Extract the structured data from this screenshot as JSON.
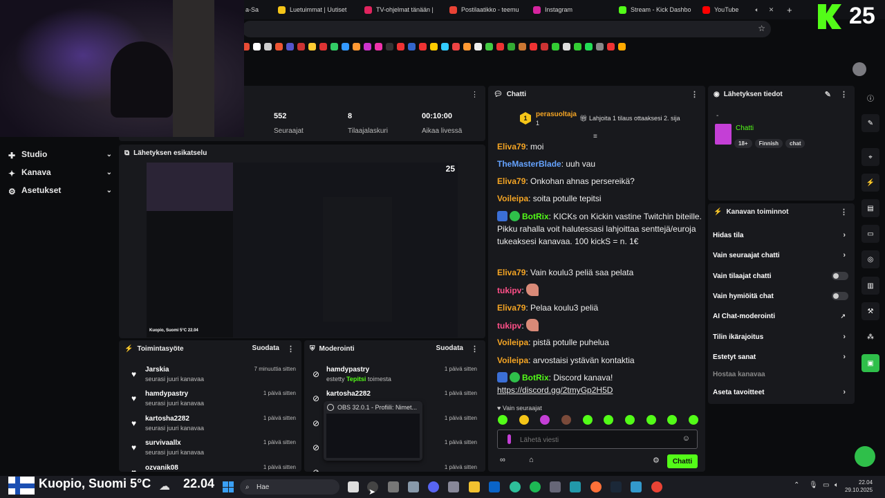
{
  "browser": {
    "tabs": [
      {
        "label": "a-Sa",
        "color": "#6aa6ff"
      },
      {
        "label": "Luetuimmat | Uutiset",
        "color": "#f5c518"
      },
      {
        "label": "TV-ohjelmat tänään |",
        "color": "#e0245e"
      },
      {
        "label": "Postilaatikko - teemu",
        "color": "#ea4335"
      },
      {
        "label": "Instagram",
        "color": "#d6249f"
      },
      {
        "label": "Stream - Kick Dashbo",
        "color": "#53fc18"
      },
      {
        "label": "YouTube",
        "color": "#ff0000"
      }
    ],
    "overlay_count": "25"
  },
  "nav": {
    "items": [
      {
        "label": "Studio"
      },
      {
        "label": "Kanava"
      },
      {
        "label": "Asetukset"
      }
    ]
  },
  "stats": [
    {
      "value": "552",
      "label": "Seuraajat"
    },
    {
      "value": "8",
      "label": "Tilaajalaskuri"
    },
    {
      "value": "00:10:00",
      "label": "Aikaa livessä"
    }
  ],
  "preview": {
    "title": "Lähetyksen esikatselu",
    "location": "Kuopio, Suomi 5°C 22.04",
    "count": "25"
  },
  "activity": {
    "title": "Toimintasyöte",
    "filter": "Suodata",
    "rows": [
      {
        "name": "Jarskia",
        "sub": "seurasi juuri kanavaa",
        "time": "7 minuuttia sitten"
      },
      {
        "name": "hamdypastry",
        "sub": "seurasi juuri kanavaa",
        "time": "1 päivä sitten"
      },
      {
        "name": "kartosha2282",
        "sub": "seurasi juuri kanavaa",
        "time": "1 päivä sitten"
      },
      {
        "name": "survivaallx",
        "sub": "seurasi juuri kanavaa",
        "time": "1 päivä sitten"
      },
      {
        "name": "ozvanik08",
        "sub": "",
        "time": "1 päivä sitten"
      }
    ]
  },
  "moderation": {
    "title": "Moderointi",
    "filter": "Suodata",
    "rows": [
      {
        "name": "hamdypastry",
        "sub_prefix": "estetty",
        "sub_highlight": "Tepitsi",
        "sub_suffix": "toimesta",
        "time": "1 päivä sitten"
      },
      {
        "name": "kartosha2282",
        "time": "1 päivä sitten"
      },
      {
        "name": "",
        "time": "1 päivä sitten"
      },
      {
        "name": "",
        "time": "1 päivä sitten"
      },
      {
        "name": "",
        "time": "1 päivä sitten"
      }
    ],
    "popup_title": "OBS 32.0.1 - Profiili: Nimet..."
  },
  "chat": {
    "title": "Chatti",
    "top_gifter": {
      "rank": "1",
      "name": "perasuoltaja",
      "count": "1"
    },
    "promo": "Lahjoita 1 tilaus ottaaksesi 2. sija",
    "messages": [
      {
        "user": "Eliva79",
        "color": "orange",
        "text": "moi"
      },
      {
        "user": "TheMasterBlade",
        "color": "blue",
        "text": "uuh vau"
      },
      {
        "user": "Eliva79",
        "color": "orange",
        "text": "Onkohan ahnas persereikä?"
      },
      {
        "user": "Voileipa",
        "color": "orange",
        "text": "soita potulle tepitsi"
      },
      {
        "user": "BotRix",
        "color": "green",
        "text": "KICKs on Kickin vastine Twitchin biteille. Pikku rahalla voit halutessasi lahjoittaa senttejä/euroja tukeaksesi kanavaa. 100 kickS = n. 1€"
      },
      {
        "user": "Eliva79",
        "color": "orange",
        "text": "Vain koulu3 peliä saa pelata"
      },
      {
        "user": "tukipv",
        "color": "pink",
        "text": ""
      },
      {
        "user": "Eliva79",
        "color": "orange",
        "text": "Pelaa koulu3 peliä"
      },
      {
        "user": "tukipv",
        "color": "pink",
        "text": ""
      },
      {
        "user": "Voileipa",
        "color": "orange",
        "text": "pistä potulle puhelua"
      },
      {
        "user": "Voileipa",
        "color": "orange",
        "text": "arvostaisi ystävän kontaktia"
      },
      {
        "user": "BotRix",
        "color": "green",
        "text": "Discord kanava!",
        "link": "https://discord.gg/2tmyGp2H5D"
      }
    ],
    "followers_only": "Vain seuraajat",
    "input_placeholder": "Lähetä viesti",
    "send_label": "Chatti"
  },
  "stream_info": {
    "title": "Lähetyksen tiedot",
    "dash": "-",
    "category": "Chatti",
    "tags": [
      "18+",
      "Finnish",
      "chat"
    ]
  },
  "channel_tools": {
    "title": "Kanavan toiminnot",
    "items": [
      {
        "label": "Hidas tila",
        "kind": "chevron"
      },
      {
        "label": "Vain seuraajat chatti",
        "kind": "chevron"
      },
      {
        "label": "Vain tilaajat chatti",
        "kind": "toggle",
        "on": false
      },
      {
        "label": "Vain hymiöitä chat",
        "kind": "toggle",
        "on": false
      },
      {
        "label": "AI Chat-moderointi",
        "kind": "external"
      },
      {
        "label": "Tilin ikärajoitus",
        "kind": "chevron"
      },
      {
        "label": "Estetyt sanat",
        "kind": "chevron"
      },
      {
        "label": "Hostaa kanavaa",
        "kind": "disabled"
      },
      {
        "label": "Aseta tavoitteet",
        "kind": "chevron"
      }
    ]
  },
  "taskbar": {
    "weather": "Kuopio, Suomi 5°C",
    "time_big": "22.04",
    "search": "Hae",
    "clock_time": "22.04",
    "clock_date": "29.10.2025"
  },
  "colors": {
    "accent": "#53fc18",
    "panel": "#18191d",
    "background": "#0b0c0e"
  }
}
